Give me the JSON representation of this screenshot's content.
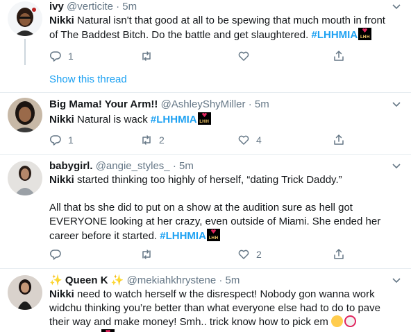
{
  "tweets": [
    {
      "display_name": "ivy",
      "handle": "@verticite",
      "time": "5m",
      "mention": "Nikki",
      "line1_rest": " Natural isn't that good at all to be spewing that much mouth in front",
      "line2": "of The Baddest Bitch. Do the battle and get slaughtered. ",
      "hashtag": "#LHHMIA",
      "reply_count": "1",
      "retweet_count": "",
      "like_count": "",
      "show_thread": "Show this thread"
    },
    {
      "display_name": "Big Mama! Your Arm!!",
      "handle": "@AshleyShyMiller",
      "time": "5m",
      "mention": "Nikki",
      "text": " Natural is wack ",
      "hashtag": "#LHHMIA",
      "reply_count": "1",
      "retweet_count": "2",
      "like_count": "4"
    },
    {
      "display_name": "babygirl.",
      "handle": "@angie_styles_",
      "time": "5m",
      "mention": "Nikki",
      "line1_rest": " started thinking too highly of herself, “dating Trick Daddy.”",
      "para2_line1": "All that bs she did to put on a show at the audition sure as hell got",
      "para2_line2": "EVERYONE looking at her crazy, even outside of Miami. She ended her",
      "para2_line3": "career before it started. ",
      "hashtag": "#LHHMIA",
      "reply_count": "",
      "retweet_count": "",
      "like_count": "2"
    },
    {
      "display_name": "Queen K",
      "sparkle_left": "✨",
      "sparkle_right": "✨",
      "handle": "@mekiahkhrystene",
      "time": "5m",
      "mention": "Nikki",
      "line1_rest": " need to watch herself w the disrespect! Nobody gon wanna work",
      "line2": "widchu thinking you’re better than what everyone else had to do to pave",
      "line3": "their way and make money! Smh.. trick know how to pick em "
    }
  ],
  "separator": "·",
  "badge_text": "LHH",
  "colors": {
    "accent": "#1da1f2",
    "secondary_text": "#657786",
    "primary_text": "#14171a",
    "divider": "#e6ecf0",
    "like_icon": "#e0245e"
  },
  "icons": [
    "reply-icon",
    "retweet-icon",
    "like-icon",
    "share-icon",
    "chevron-down-icon"
  ]
}
